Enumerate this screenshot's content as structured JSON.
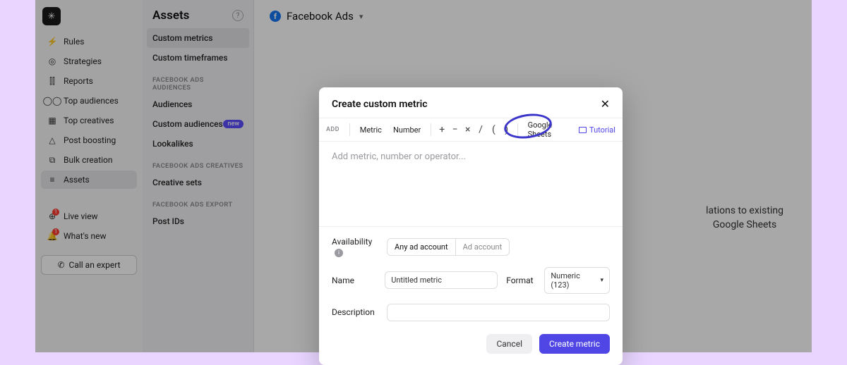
{
  "sidebar_primary": {
    "items": [
      {
        "label": "Rules",
        "icon": "⚡"
      },
      {
        "label": "Strategies",
        "icon": "◎"
      },
      {
        "label": "Reports",
        "icon": "⫿⫿"
      },
      {
        "label": "Top audiences",
        "icon": "◯◯"
      },
      {
        "label": "Top creatives",
        "icon": "▦"
      },
      {
        "label": "Post boosting",
        "icon": "△"
      },
      {
        "label": "Bulk creation",
        "icon": "⧉"
      },
      {
        "label": "Assets",
        "icon": "≡"
      }
    ],
    "footer_items": [
      {
        "label": "Live view",
        "icon": "⊕",
        "badge": "1"
      },
      {
        "label": "What's new",
        "icon": "🔔",
        "badge": "1"
      }
    ],
    "call_expert": "Call an expert"
  },
  "sidebar_secondary": {
    "title": "Assets",
    "items_top": [
      {
        "label": "Custom metrics",
        "active": true
      },
      {
        "label": "Custom timeframes"
      }
    ],
    "group_audiences": {
      "label": "FACEBOOK ADS AUDIENCES",
      "items": [
        {
          "label": "Audiences"
        },
        {
          "label": "Custom audiences",
          "badge": "new"
        },
        {
          "label": "Lookalikes"
        }
      ]
    },
    "group_creatives": {
      "label": "FACEBOOK ADS CREATIVES",
      "items": [
        {
          "label": "Creative sets"
        }
      ]
    },
    "group_export": {
      "label": "FACEBOOK ADS EXPORT",
      "items": [
        {
          "label": "Post IDs"
        }
      ]
    }
  },
  "main": {
    "crumb": "Facebook Ads",
    "bg_hint_line1": "lations to existing",
    "bg_hint_line2": "Google Sheets"
  },
  "modal": {
    "title": "Create custom metric",
    "toolbar": {
      "add_label": "ADD",
      "metric": "Metric",
      "number": "Number",
      "gsheets": "Google Sheets",
      "tutorial": "Tutorial"
    },
    "formula_placeholder": "Add metric, number or operator...",
    "availability": {
      "label": "Availability",
      "opt_any": "Any ad account",
      "opt_single": "Ad account"
    },
    "name": {
      "label": "Name",
      "value": "Untitled metric"
    },
    "format": {
      "label": "Format",
      "value": "Numeric (123)"
    },
    "description": {
      "label": "Description",
      "value": ""
    },
    "actions": {
      "cancel": "Cancel",
      "create": "Create metric"
    }
  }
}
